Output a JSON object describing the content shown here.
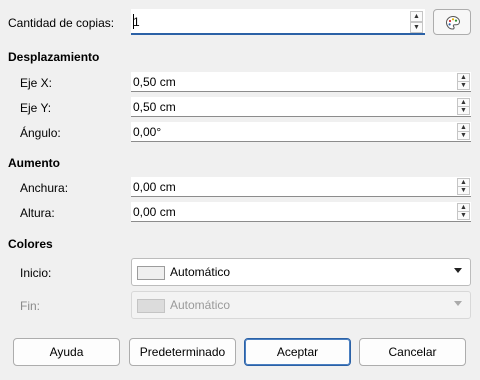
{
  "copies": {
    "label": "Cantidad de copias:",
    "value": "1"
  },
  "sections": {
    "placement": "Desplazamiento",
    "enlargement": "Aumento",
    "colors": "Colores"
  },
  "placement": {
    "x_label": "Eje X:",
    "x_value": "0,50 cm",
    "y_label": "Eje Y:",
    "y_value": "0,50 cm",
    "angle_label": "Ángulo:",
    "angle_value": "0,00°"
  },
  "enlargement": {
    "width_label": "Anchura:",
    "width_value": "0,00 cm",
    "height_label": "Altura:",
    "height_value": "0,00 cm"
  },
  "colors": {
    "start_label": "Inicio:",
    "start_value": "Automático",
    "start_swatch": "#efefef",
    "end_label": "Fin:",
    "end_value": "Automático",
    "end_swatch": "#dcdcdc"
  },
  "buttons": {
    "help": "Ayuda",
    "reset": "Predeterminado",
    "ok": "Aceptar",
    "cancel": "Cancelar"
  }
}
